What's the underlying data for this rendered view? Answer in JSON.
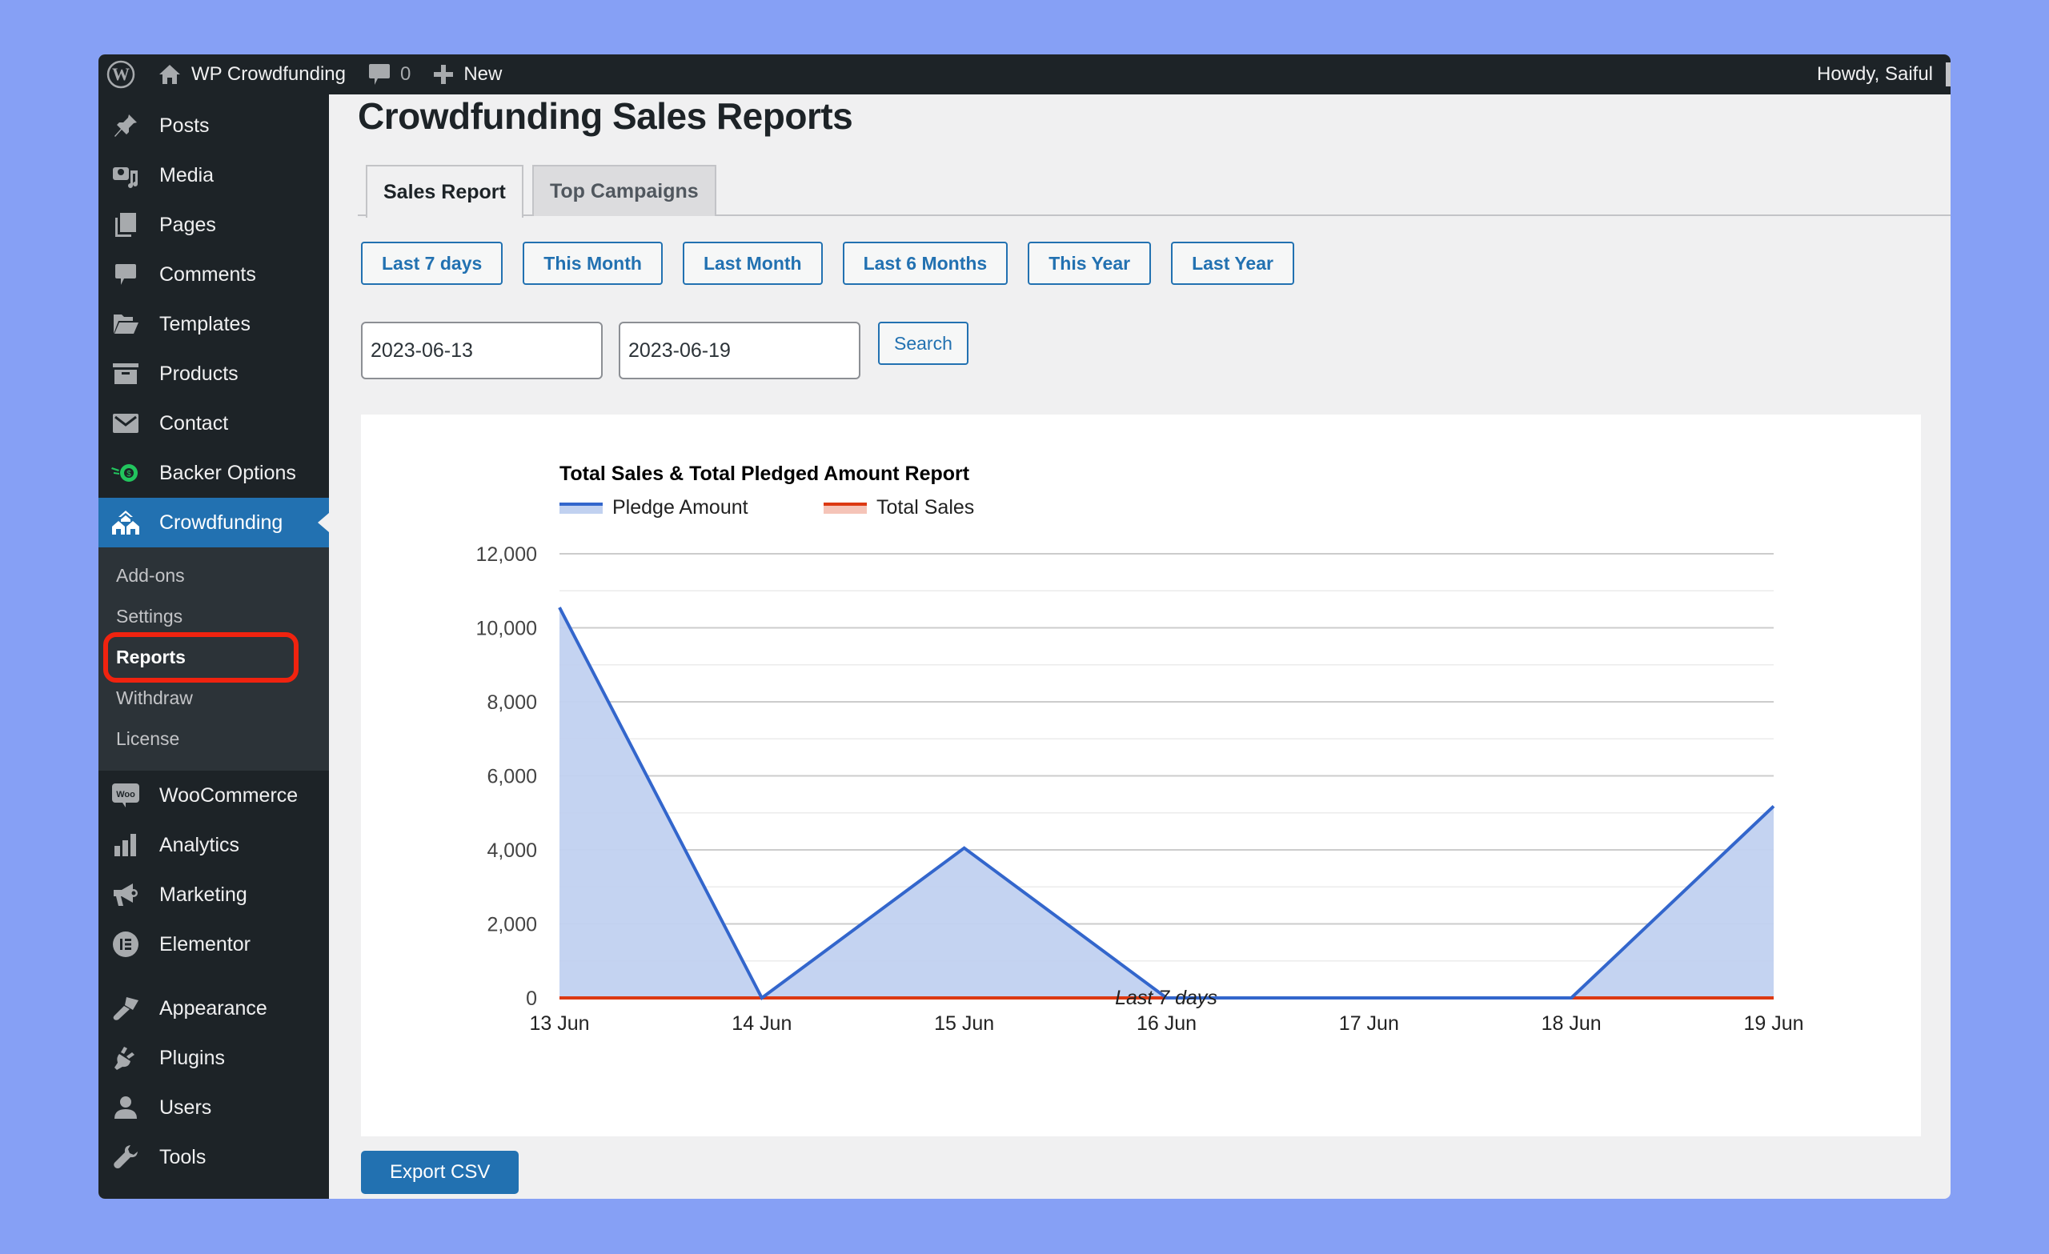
{
  "adminbar": {
    "site_name": "WP Crowdfunding",
    "comments_count": "0",
    "new_label": "New",
    "howdy": "Howdy, Saiful"
  },
  "sidebar": {
    "items_top": [
      {
        "label": "Posts",
        "icon": "pin-icon"
      },
      {
        "label": "Media",
        "icon": "media-icon"
      },
      {
        "label": "Pages",
        "icon": "pages-icon"
      },
      {
        "label": "Comments",
        "icon": "comment-icon"
      },
      {
        "label": "Templates",
        "icon": "folder-icon"
      },
      {
        "label": "Products",
        "icon": "archive-icon"
      },
      {
        "label": "Contact",
        "icon": "envelope-icon"
      },
      {
        "label": "Backer Options",
        "icon": "money-icon"
      },
      {
        "label": "Crowdfunding",
        "icon": "houses-icon"
      }
    ],
    "submenu": [
      {
        "label": "Add-ons"
      },
      {
        "label": "Settings"
      },
      {
        "label": "Reports"
      },
      {
        "label": "Withdraw"
      },
      {
        "label": "License"
      }
    ],
    "items_bottom": [
      {
        "label": "WooCommerce",
        "icon": "woo-icon"
      },
      {
        "label": "Analytics",
        "icon": "bar-chart-icon"
      },
      {
        "label": "Marketing",
        "icon": "megaphone-icon"
      },
      {
        "label": "Elementor",
        "icon": "elementor-icon"
      }
    ],
    "items_tail": [
      {
        "label": "Appearance",
        "icon": "brush-icon"
      },
      {
        "label": "Plugins",
        "icon": "plug-icon"
      },
      {
        "label": "Users",
        "icon": "user-icon"
      },
      {
        "label": "Tools",
        "icon": "wrench-icon"
      }
    ],
    "active_item": "Crowdfunding",
    "active_subitem": "Reports"
  },
  "main": {
    "title": "Crowdfunding Sales Reports",
    "tabs": [
      {
        "label": "Sales Report",
        "active": true
      },
      {
        "label": "Top Campaigns",
        "active": false
      }
    ],
    "range_buttons": [
      "Last 7 days",
      "This Month",
      "Last Month",
      "Last 6 Months",
      "This Year",
      "Last Year"
    ],
    "date_from": "2023-06-13",
    "date_to": "2023-06-19",
    "search_label": "Search",
    "export_label": "Export CSV"
  },
  "colors": {
    "accent": "#2271b1",
    "pledge_line": "#3366cc",
    "pledge_fill": "#c1d1f0",
    "sales_line": "#dc3912",
    "sales_fill": "#f5c4b8",
    "highlight": "#f0230f"
  },
  "chart_data": {
    "type": "area",
    "title": "Total Sales & Total Pledged Amount Report",
    "categories": [
      "13 Jun",
      "14 Jun",
      "15 Jun",
      "16 Jun",
      "17 Jun",
      "18 Jun",
      "19 Jun"
    ],
    "series": [
      {
        "name": "Pledge Amount",
        "values": [
          10550,
          0,
          4050,
          0,
          0,
          0,
          5180
        ]
      },
      {
        "name": "Total Sales",
        "values": [
          0,
          0,
          0,
          0,
          0,
          0,
          0
        ]
      }
    ],
    "xlabel": "Last 7 days",
    "ylabel": "",
    "ylim": [
      0,
      12000
    ],
    "yticks": [
      0,
      2000,
      4000,
      6000,
      8000,
      10000,
      12000
    ],
    "ytick_labels": [
      "0",
      "2,000",
      "4,000",
      "6,000",
      "8,000",
      "10,000",
      "12,000"
    ],
    "minor_gridlines": true,
    "grid": true,
    "legend_position": "top-left"
  }
}
